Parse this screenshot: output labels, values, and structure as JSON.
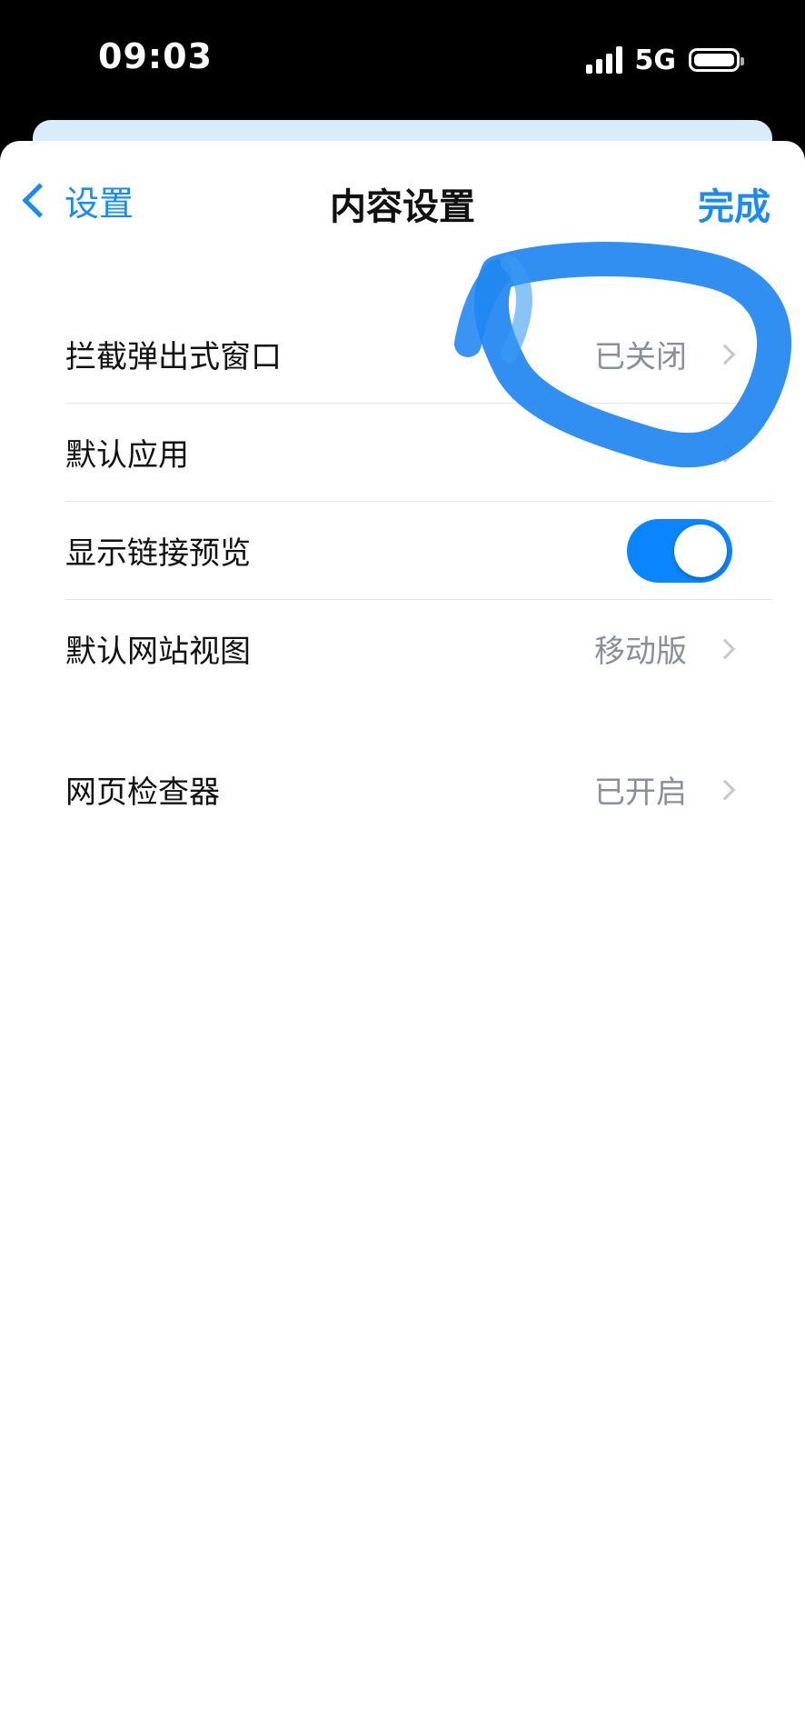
{
  "status_bar": {
    "time": "09:03",
    "network": "5G"
  },
  "nav": {
    "back_label": "设置",
    "title": "内容设置",
    "done_label": "完成"
  },
  "section1": [
    {
      "label": "拦截弹出式窗口",
      "value": "已关闭"
    },
    {
      "label": "默认应用",
      "value": ""
    },
    {
      "label": "显示链接预览",
      "toggle": true
    },
    {
      "label": "默认网站视图",
      "value": "移动版"
    }
  ],
  "section2": [
    {
      "label": "网页检查器",
      "value": "已开启"
    }
  ],
  "colors": {
    "accent": "#1a8cf0",
    "toggle_on": "#0a84ff",
    "annotation": "#1f86f0"
  },
  "icons": {
    "back": "chevron-left-icon",
    "row": "chevron-right-icon",
    "annotation": "hand-drawn-circle"
  }
}
